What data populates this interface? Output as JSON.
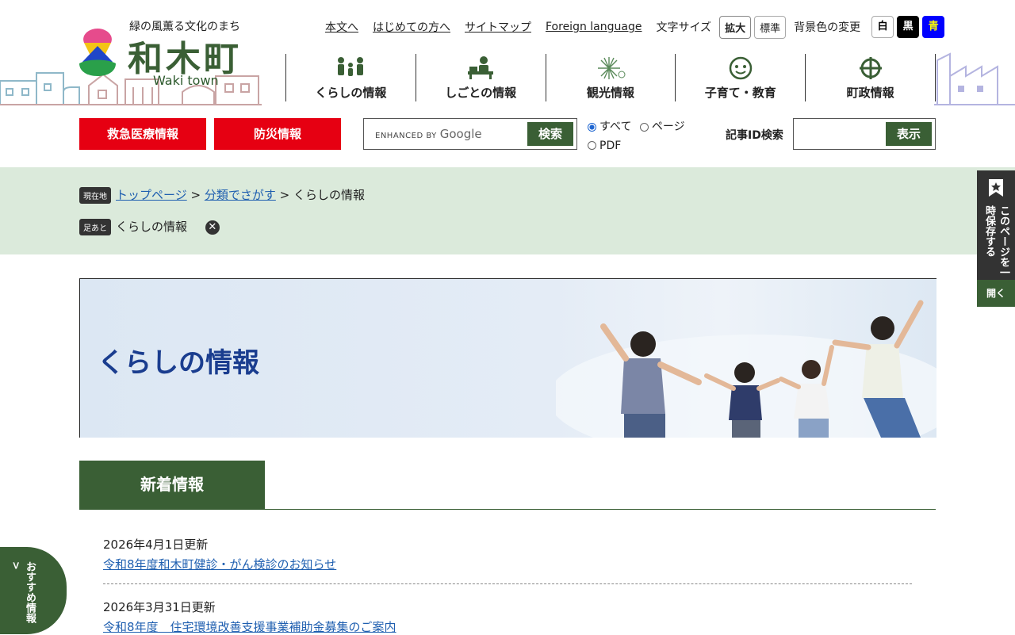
{
  "header": {
    "tagline": "緑の風薫る文化のまち",
    "town_name": "和木町",
    "town_en": "Waki town",
    "links": [
      "本文へ",
      "はじめての方へ",
      "サイトマップ",
      "Foreign language"
    ],
    "font_size_label": "文字サイズ",
    "font_size_buttons": [
      "拡大",
      "標準"
    ],
    "bg_label": "背景色の変更",
    "bg_buttons": [
      {
        "label": "白",
        "bg": "#ffffff",
        "fg": "#000000"
      },
      {
        "label": "黒",
        "bg": "#000000",
        "fg": "#ffffff"
      },
      {
        "label": "青",
        "bg": "#0000ff",
        "fg": "#ffff00"
      }
    ]
  },
  "nav": [
    {
      "label": "くらしの情報",
      "icon": "family-icon"
    },
    {
      "label": "しごとの情報",
      "icon": "work-desk-icon"
    },
    {
      "label": "観光情報",
      "icon": "fireworks-icon"
    },
    {
      "label": "子育て・教育",
      "icon": "child-face-icon"
    },
    {
      "label": "町政情報",
      "icon": "town-emblem-icon"
    }
  ],
  "quick": {
    "emergency": "救急医療情報",
    "disaster": "防災情報",
    "search_brand_small": "ENHANCED BY",
    "search_brand": "Google",
    "search_button": "検索",
    "scope_options": [
      "すべて",
      "ページ",
      "PDF"
    ],
    "scope_selected": "すべて",
    "article_id_label": "記事ID検索",
    "article_id_button": "表示"
  },
  "breadcrumb": {
    "current_tag": "現在地",
    "items": [
      "トップページ",
      "分類でさがす"
    ],
    "current": "くらしの情報",
    "history_tag": "足あと",
    "history_item": "くらしの情報"
  },
  "hero": {
    "title": "くらしの情報"
  },
  "news": {
    "heading": "新着情報",
    "items": [
      {
        "date": "2026年4月1日更新",
        "title": "令和8年度和木町健診・がん検診のお知らせ"
      },
      {
        "date": "2026年3月31日更新",
        "title": "令和8年度　住宅環境改善支援事業補助金募集のご案内"
      }
    ]
  },
  "side": {
    "bookmark_text": "このページを一時保存する",
    "bookmark_open": "開く",
    "recommend_text": "おすすめ情報",
    "recommend_arrow": ">"
  },
  "colors": {
    "brand_green": "#3a5f35",
    "emergency_red": "#e60012",
    "link_blue": "#1f5fb0",
    "breadcrumb_bg": "#dbeadb"
  }
}
